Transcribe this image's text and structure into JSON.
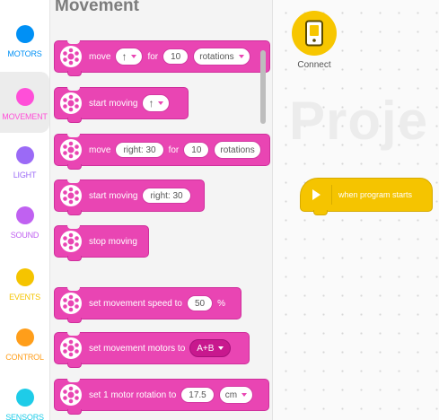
{
  "categories": [
    {
      "label": "MOTORS",
      "color": "#0090f5",
      "text_color": "#0090f5"
    },
    {
      "label": "MOVEMENT",
      "color": "#ff4fd8",
      "text_color": "#ff4fd8",
      "selected": true
    },
    {
      "label": "LIGHT",
      "color": "#9b6af6",
      "text_color": "#9b6af6"
    },
    {
      "label": "SOUND",
      "color": "#c061f1",
      "text_color": "#c061f1"
    },
    {
      "label": "EVENTS",
      "color": "#f5c400",
      "text_color": "#f5c400"
    },
    {
      "label": "CONTROL",
      "color": "#ff9e1a",
      "text_color": "#ff9e1a"
    },
    {
      "label": "SENSORS",
      "color": "#1ecce8",
      "text_color": "#1ecce8"
    }
  ],
  "flyout": {
    "title": "Movement",
    "blocks": {
      "move1": {
        "text": "move",
        "direction": "↑",
        "for": "for",
        "amount": "10",
        "unit": "rotations"
      },
      "start1": {
        "text": "start moving",
        "direction": "↑"
      },
      "move2": {
        "text": "move",
        "steer": "right: 30",
        "for": "for",
        "amount": "10",
        "unit": "rotations"
      },
      "start2": {
        "text": "start moving",
        "steer": "right: 30"
      },
      "stop": {
        "text": "stop moving"
      },
      "speed": {
        "text": "set movement speed to",
        "value": "50",
        "suffix": "%"
      },
      "motors": {
        "text": "set movement motors to",
        "value": "A+B"
      },
      "rotation": {
        "text": "set 1 motor rotation to",
        "value": "17.5",
        "unit": "cm"
      }
    }
  },
  "canvas": {
    "connect_label": "Connect",
    "watermark": "Proje",
    "hat_block": {
      "text": "when program starts"
    }
  },
  "colors": {
    "movement": "#e945b3",
    "events": "#f5c400"
  },
  "icons": {
    "block_icon": "movement-wheel-icon",
    "connect": "hub-device-icon"
  }
}
